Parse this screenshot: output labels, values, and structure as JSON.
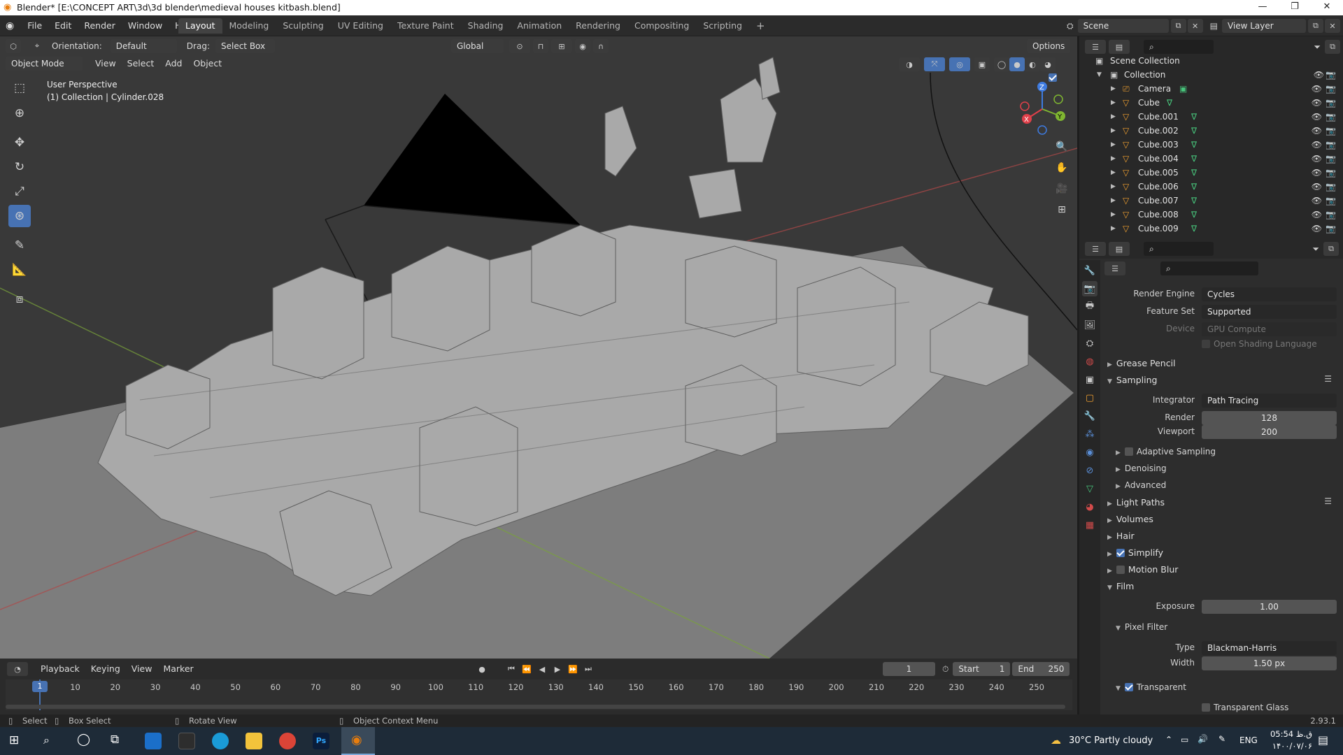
{
  "window": {
    "title": "Blender* [E:\\CONCEPT ART\\3d\\3d blender\\medieval houses kitbash.blend]"
  },
  "menu": [
    "File",
    "Edit",
    "Render",
    "Window",
    "Help"
  ],
  "workspaces": [
    "Layout",
    "Modeling",
    "Sculpting",
    "UV Editing",
    "Texture Paint",
    "Shading",
    "Animation",
    "Rendering",
    "Compositing",
    "Scripting"
  ],
  "scene": {
    "name": "Scene",
    "view_layer": "View Layer"
  },
  "tool_header": {
    "orientation_label": "Orientation:",
    "orientation_value": "Default",
    "drag_label": "Drag:",
    "drag_value": "Select Box",
    "transform_orientation": "Global",
    "options": "Options"
  },
  "viewport_header": {
    "mode": "Object Mode",
    "menus": [
      "View",
      "Select",
      "Add",
      "Object"
    ]
  },
  "viewport_info": {
    "perspective": "User Perspective",
    "collection": "(1) Collection | Cylinder.028"
  },
  "outliner": {
    "root": "Scene Collection",
    "collection": "Collection",
    "items": [
      "Camera",
      "Cube",
      "Cube.001",
      "Cube.002",
      "Cube.003",
      "Cube.004",
      "Cube.005",
      "Cube.006",
      "Cube.007",
      "Cube.008",
      "Cube.009"
    ]
  },
  "properties": {
    "render_engine_label": "Render Engine",
    "render_engine": "Cycles",
    "feature_set_label": "Feature Set",
    "feature_set": "Supported",
    "device_label": "Device",
    "device": "GPU Compute",
    "osl": "Open Shading Language",
    "grease_pencil": "Grease Pencil",
    "sampling": "Sampling",
    "integrator_label": "Integrator",
    "integrator": "Path Tracing",
    "render_label": "Render",
    "render_samples": "128",
    "viewport_label": "Viewport",
    "viewport_samples": "200",
    "adaptive_sampling": "Adaptive Sampling",
    "denoising": "Denoising",
    "advanced": "Advanced",
    "light_paths": "Light Paths",
    "volumes": "Volumes",
    "hair": "Hair",
    "simplify": "Simplify",
    "motion_blur": "Motion Blur",
    "film": "Film",
    "exposure_label": "Exposure",
    "exposure": "1.00",
    "pixel_filter": "Pixel Filter",
    "type_label": "Type",
    "type": "Blackman-Harris",
    "width_label": "Width",
    "width": "1.50 px",
    "transparent": "Transparent",
    "transparent_glass": "Transparent Glass"
  },
  "timeline": {
    "menus": [
      "Playback",
      "Keying",
      "View",
      "Marker"
    ],
    "current_frame": "1",
    "start_label": "Start",
    "start": "1",
    "end_label": "End",
    "end": "250",
    "ticks": [
      "1",
      "10",
      "20",
      "30",
      "40",
      "50",
      "60",
      "70",
      "80",
      "90",
      "100",
      "110",
      "120",
      "130",
      "140",
      "150",
      "160",
      "170",
      "180",
      "190",
      "200",
      "210",
      "220",
      "230",
      "240",
      "250"
    ]
  },
  "status": {
    "select": "Select",
    "box_select": "Box Select",
    "rotate_view": "Rotate View",
    "context_menu": "Object Context Menu",
    "version": "2.93.1"
  },
  "taskbar": {
    "weather": "30°C  Partly cloudy",
    "lang": "ENG",
    "time": "05:54 ق.ظ",
    "date": "۱۴۰۰/۰۷/۰۶"
  },
  "colors": {
    "accent": "#4772b3",
    "viewport_bg": "#393939",
    "panel_bg": "#2d2d2d"
  }
}
